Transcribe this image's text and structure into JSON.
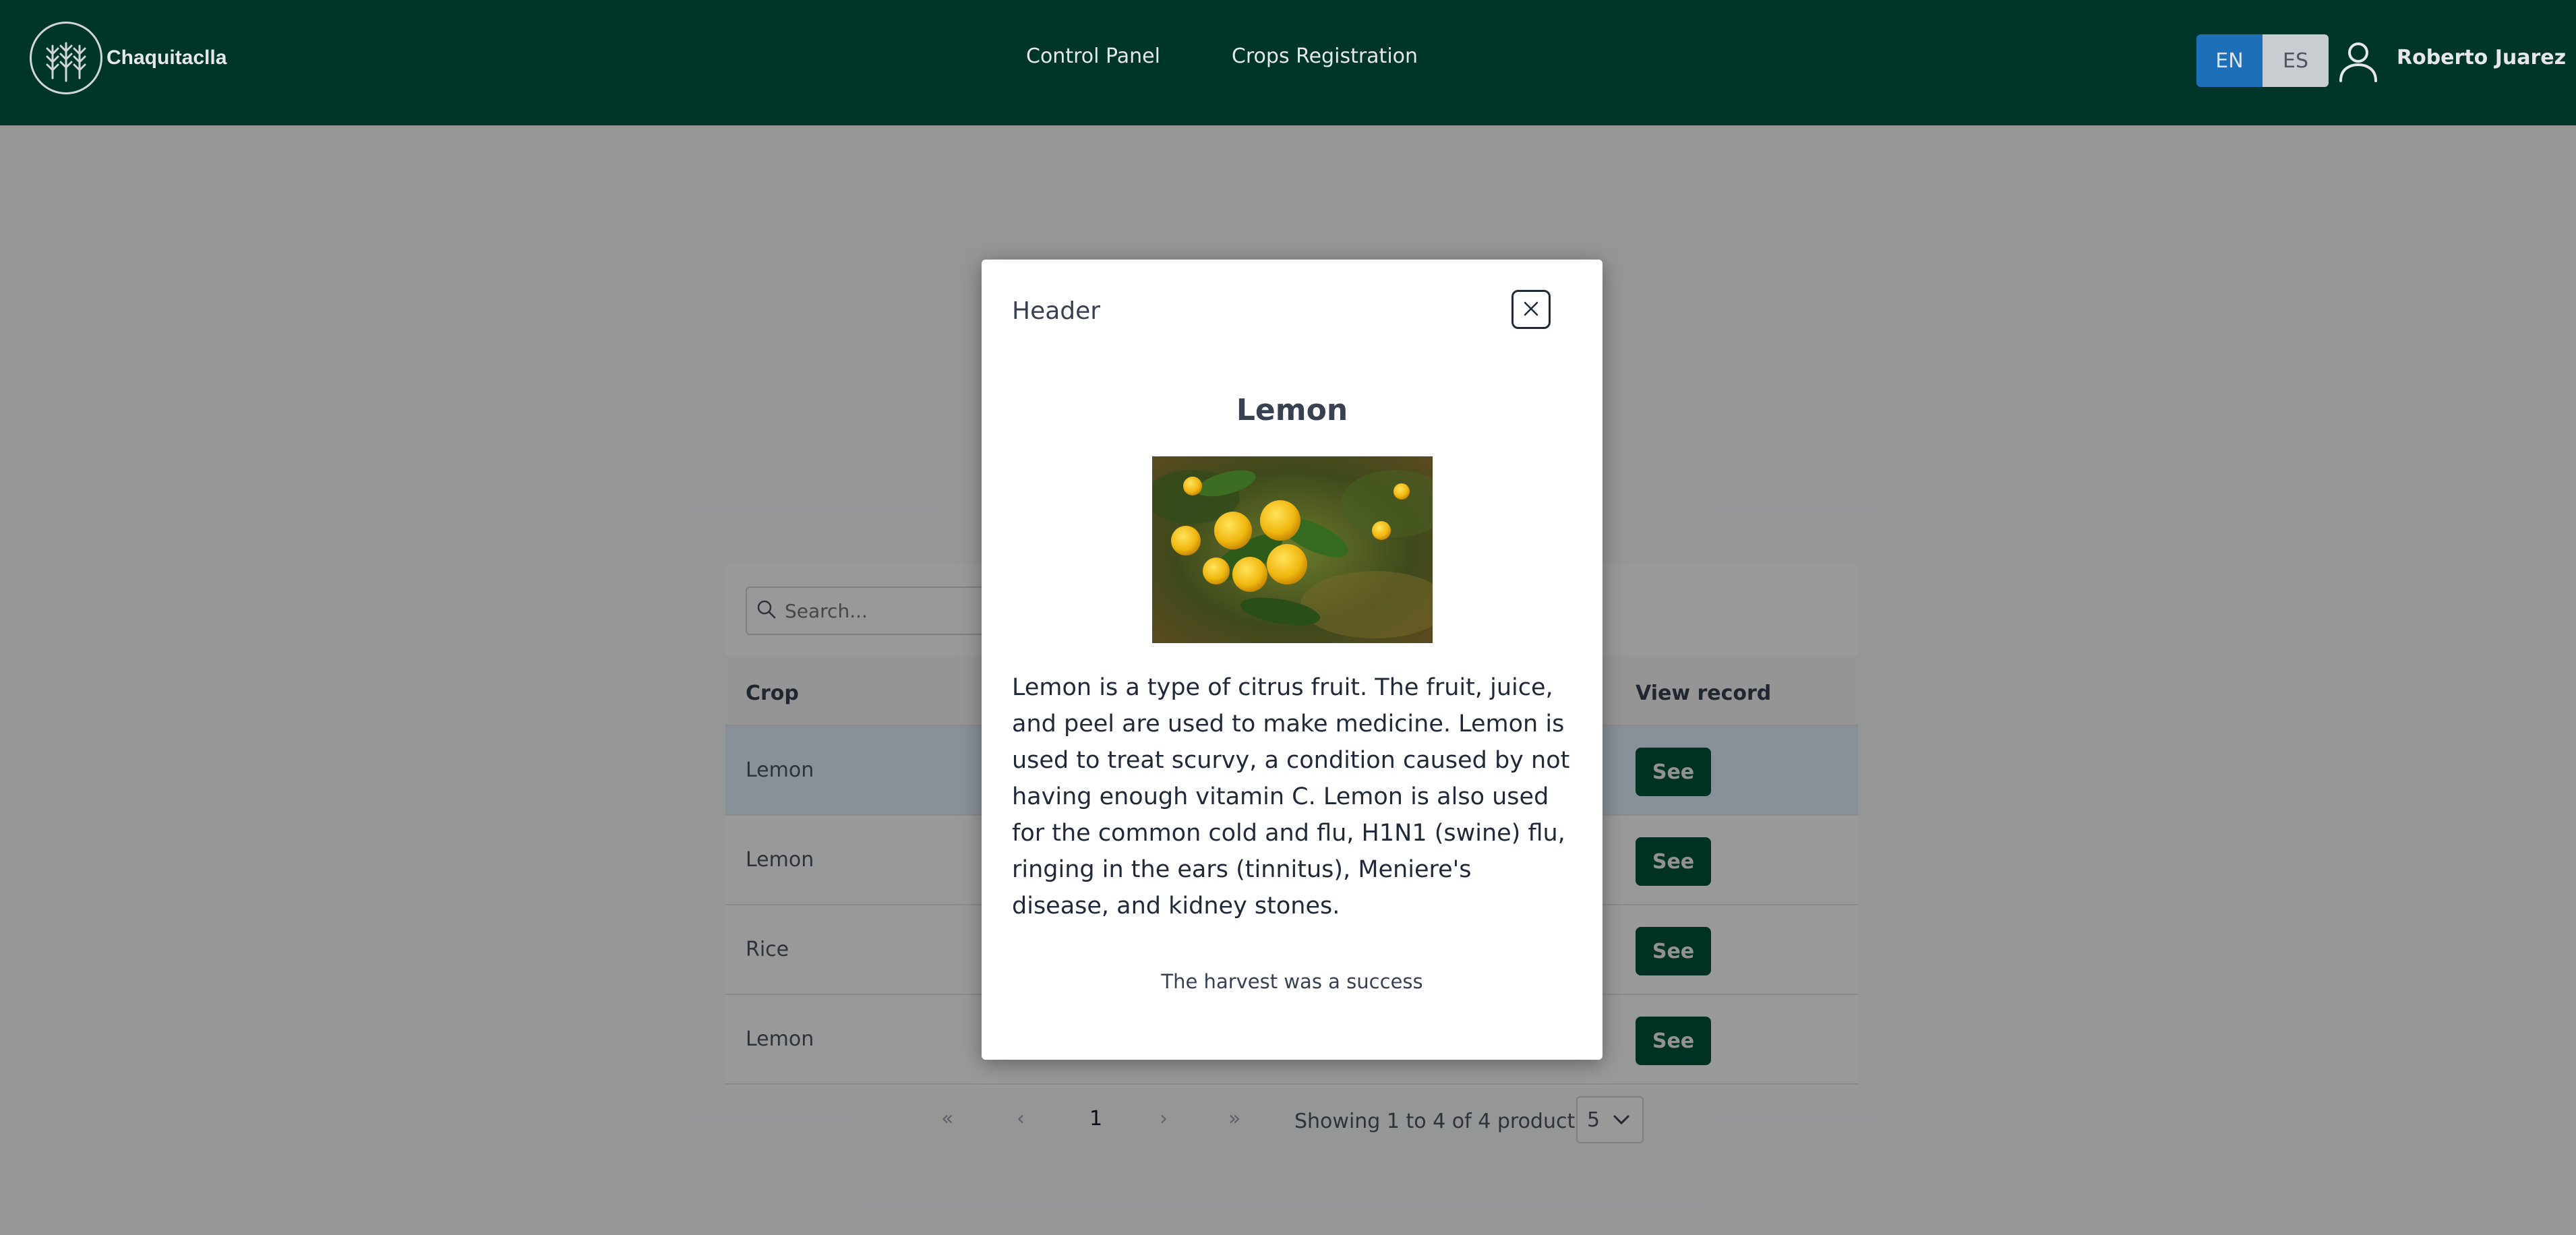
{
  "app": {
    "brand_name": "Chaquitaclla"
  },
  "nav": {
    "items": [
      {
        "label": "Control Panel"
      },
      {
        "label": "Crops Registration"
      }
    ]
  },
  "language": {
    "en": "EN",
    "es": "ES",
    "active": "EN"
  },
  "user": {
    "name": "Roberto Juarez"
  },
  "table": {
    "search_placeholder": "Search...",
    "columns": {
      "crop": "Crop",
      "view_record": "View record"
    },
    "rows": [
      {
        "crop": "Lemon",
        "action": "See",
        "selected": true
      },
      {
        "crop": "Lemon",
        "action": "See",
        "selected": false
      },
      {
        "crop": "Rice",
        "action": "See",
        "selected": false
      },
      {
        "crop": "Lemon",
        "action": "See",
        "selected": false
      }
    ]
  },
  "pagination": {
    "first": "«",
    "prev": "‹",
    "current_page": "1",
    "next": "›",
    "last": "»",
    "summary": "Showing 1 to 4 of 4 products",
    "rows_per_page": "5"
  },
  "modal": {
    "title": "Header",
    "crop_name": "Lemon",
    "description": "Lemon is a type of citrus fruit. The fruit, juice, and peel are used to make medicine. Lemon is used to treat scurvy, a condition caused by not having enough vitamin C. Lemon is also used for the common cold and flu, H1N1 (swine) flu, ringing in the ears (tinnitus), Meniere's disease, and kidney stones.",
    "note": "The harvest was a success"
  },
  "colors": {
    "topbar": "#00362a",
    "primary_button": "#00543c",
    "lang_active": "#1d6fb8",
    "row_selected": "#e3f0fd"
  }
}
